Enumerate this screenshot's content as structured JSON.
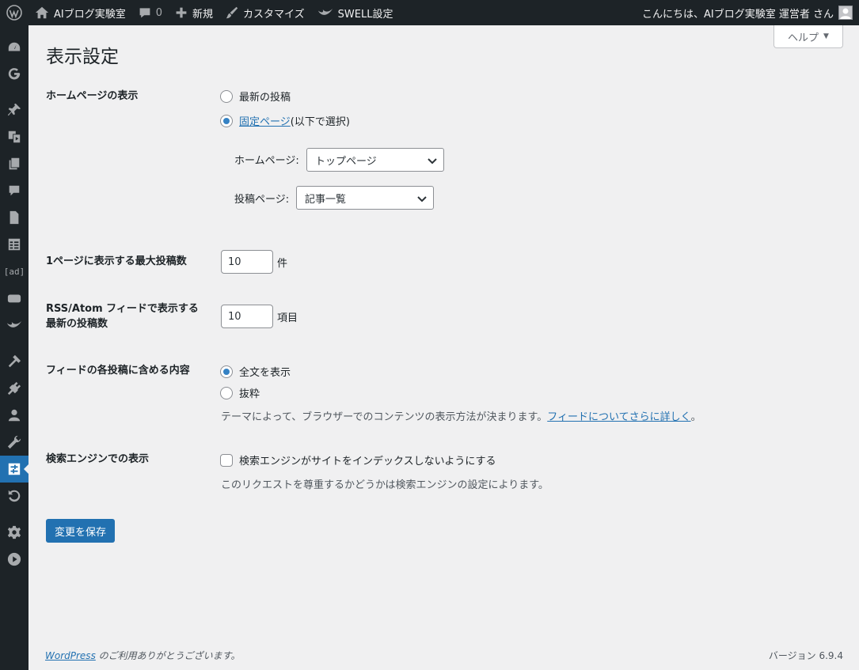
{
  "adminbar": {
    "site_name": "AIブログ実験室",
    "comments_count": "0",
    "new_label": "新規",
    "customize_label": "カスタマイズ",
    "swell_label": "SWELL設定",
    "greeting": "こんにちは、AIブログ実験室 運営者 さん"
  },
  "help_tab": {
    "label": "ヘルプ",
    "arrow": "▼"
  },
  "page_title": "表示設定",
  "homepage": {
    "label": "ホームページの表示",
    "option_latest": "最新の投稿",
    "option_static_link": "固定ページ",
    "option_static_suffix": " (以下で選択)",
    "homepage_label": "ホームページ:",
    "homepage_value": "トップページ",
    "postspage_label": "投稿ページ:",
    "postspage_value": "記事一覧",
    "selected": "static"
  },
  "posts_per_page": {
    "label": "1ページに表示する最大投稿数",
    "value": "10",
    "unit": "件"
  },
  "rss": {
    "label_line1": "RSS/Atom フィードで表示する",
    "label_line2": "最新の投稿数",
    "value": "10",
    "unit": "項目"
  },
  "feed_content": {
    "label": "フィードの各投稿に含める内容",
    "option_full": "全文を表示",
    "option_excerpt": "抜粋",
    "desc_prefix": "テーマによって、ブラウザーでのコンテンツの表示方法が決まります。",
    "desc_link": "フィードについてさらに詳しく",
    "desc_suffix": "。",
    "selected": "full"
  },
  "search_engine": {
    "label": "検索エンジンでの表示",
    "checkbox_label": "検索エンジンがサイトをインデックスしないようにする",
    "checked": false,
    "desc": "このリクエストを尊重するかどうかは検索エンジンの設定によります。"
  },
  "save_button": "変更を保存",
  "footer": {
    "wp_link": "WordPress",
    "thanks": " のご利用ありがとうございます。",
    "version": "バージョン 6.9.4"
  },
  "sidemenu": {
    "ad_text": "[ad]"
  }
}
